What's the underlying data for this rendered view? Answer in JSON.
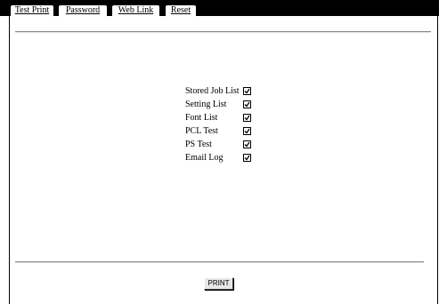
{
  "tabs": [
    {
      "label": "Test Print",
      "active": true
    },
    {
      "label": "Password",
      "active": false
    },
    {
      "label": "Web Link",
      "active": false
    },
    {
      "label": "Reset",
      "active": false
    }
  ],
  "options": [
    {
      "label": "Stored Job List",
      "checked": true
    },
    {
      "label": "Setting List",
      "checked": true
    },
    {
      "label": "Font List",
      "checked": true
    },
    {
      "label": "PCL Test",
      "checked": true
    },
    {
      "label": "PS Test",
      "checked": true
    },
    {
      "label": "Email Log",
      "checked": true
    }
  ],
  "print_button": {
    "label": "PRINT"
  },
  "colors": {
    "tab_bar": "#000000",
    "page_bg": "#ffffff",
    "button_face": "#e6e6e6"
  }
}
